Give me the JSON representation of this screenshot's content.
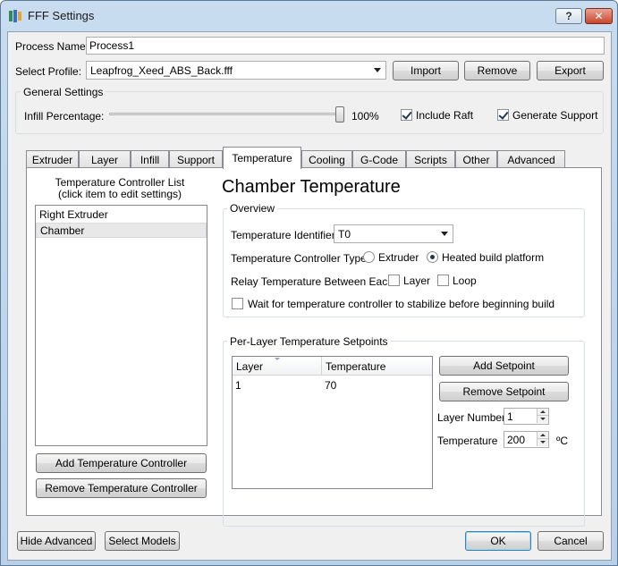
{
  "window": {
    "title": "FFF Settings",
    "help_label": "?",
    "close_label": "✕"
  },
  "process": {
    "name_label": "Process Name:",
    "name_value": "Process1"
  },
  "profile": {
    "label": "Select Profile:",
    "selected": "Leapfrog_Xeed_ABS_Back.fff",
    "import_label": "Import",
    "remove_label": "Remove",
    "export_label": "Export"
  },
  "general": {
    "title": "General Settings",
    "infill_label": "Infill Percentage:",
    "infill_value": "100%",
    "infill_level": 1.0,
    "include_raft_label": "Include Raft",
    "include_raft_checked": true,
    "generate_support_label": "Generate Support",
    "generate_support_checked": true
  },
  "tabs": [
    {
      "label": "Extruder"
    },
    {
      "label": "Layer"
    },
    {
      "label": "Infill"
    },
    {
      "label": "Support"
    },
    {
      "label": "Temperature",
      "active": true
    },
    {
      "label": "Cooling"
    },
    {
      "label": "G-Code"
    },
    {
      "label": "Scripts"
    },
    {
      "label": "Other"
    },
    {
      "label": "Advanced"
    }
  ],
  "controllers": {
    "list_title_line1": "Temperature Controller List",
    "list_title_line2": "(click item to edit settings)",
    "items": [
      {
        "label": "Right Extruder"
      },
      {
        "label": "Chamber",
        "selected": true
      }
    ],
    "add_label": "Add Temperature Controller",
    "remove_label": "Remove Temperature Controller"
  },
  "detail": {
    "heading": "Chamber Temperature",
    "overview_title": "Overview",
    "identifier_label": "Temperature Identifier",
    "identifier_value": "T0",
    "type_label": "Temperature Controller Type:",
    "type_extruder_label": "Extruder",
    "type_platform_label": "Heated build platform",
    "type_selected": "Heated build platform",
    "relay_label": "Relay Temperature Between Each:",
    "relay_layer_label": "Layer",
    "relay_loop_label": "Loop",
    "wait_label": "Wait for temperature controller to stabilize before beginning build"
  },
  "setpoints": {
    "title": "Per-Layer Temperature Setpoints",
    "columns": [
      "Layer",
      "Temperature"
    ],
    "rows": [
      [
        "1",
        "70"
      ]
    ],
    "add_label": "Add Setpoint",
    "remove_label": "Remove Setpoint",
    "layer_number_label": "Layer Number",
    "layer_number_value": "1",
    "temperature_label": "Temperature",
    "temperature_value": "200",
    "unit": "ºC"
  },
  "footer": {
    "hide_advanced_label": "Hide Advanced",
    "select_models_label": "Select Models",
    "ok_label": "OK",
    "cancel_label": "Cancel"
  }
}
